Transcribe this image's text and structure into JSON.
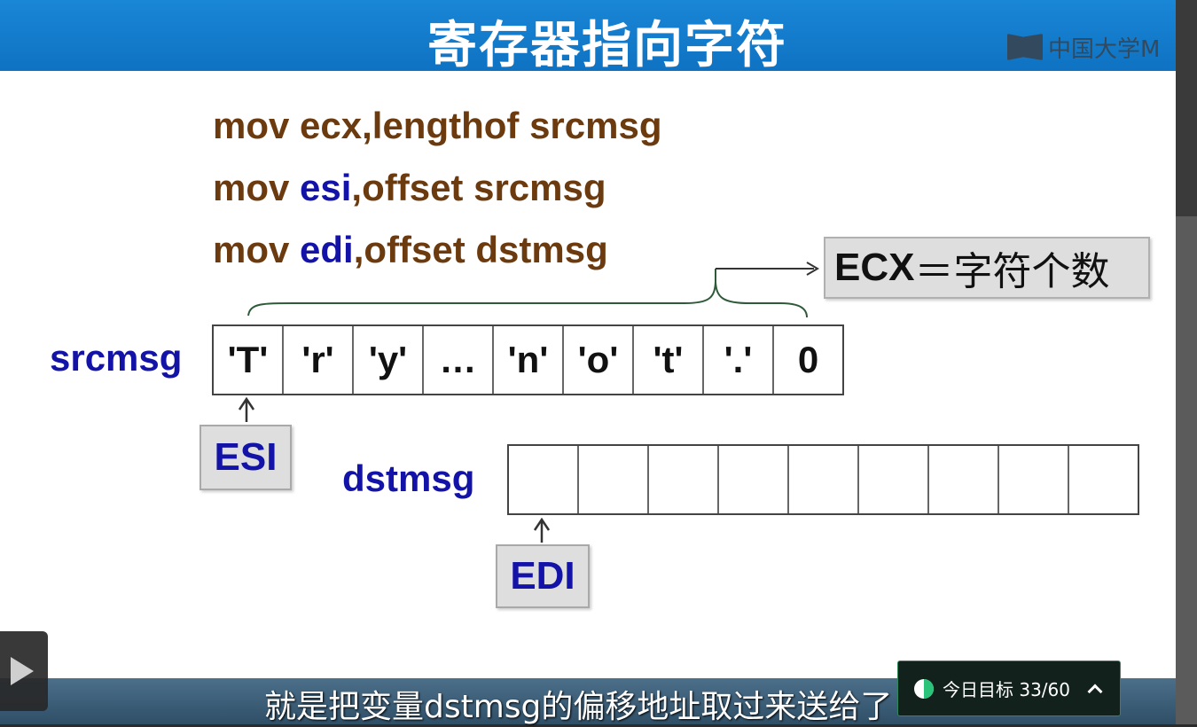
{
  "slide": {
    "title": "寄存器指向字符",
    "logo_text": "中国大学M",
    "code_lines": [
      {
        "op": "mov",
        "reg": "ecx,",
        "rest": "lengthof srcmsg"
      },
      {
        "op": "mov",
        "reg": "esi",
        "rest": ",offset srcmsg"
      },
      {
        "op": "mov",
        "reg": "edi",
        "rest": ",offset dstmsg"
      }
    ],
    "srcmsg": {
      "label": "srcmsg",
      "cells": [
        "'T'",
        "'r'",
        "'y'",
        "…",
        "'n'",
        "'o'",
        "'t'",
        "'.'",
        "0"
      ]
    },
    "dstmsg": {
      "label": "dstmsg",
      "cells": [
        "",
        "",
        "",
        "",
        "",
        "",
        "",
        "",
        ""
      ]
    },
    "esi_label": "ESI",
    "edi_label": "EDI",
    "ecx_note": {
      "reg": "ECX",
      "text": "＝字符个数"
    }
  },
  "player": {
    "subtitle": "就是把变量dstmsg的偏移地址取过来送给了",
    "goal_label": "今日目标 33/60"
  },
  "colors": {
    "title_bar": "#1a86d6",
    "code_brown": "#6b3a0e",
    "register_blue": "#1313a8",
    "goal_green": "#2ac37a"
  },
  "icons": [
    "play-icon",
    "goal-progress-icon",
    "chevron-up-icon",
    "mooc-logo-icon"
  ]
}
